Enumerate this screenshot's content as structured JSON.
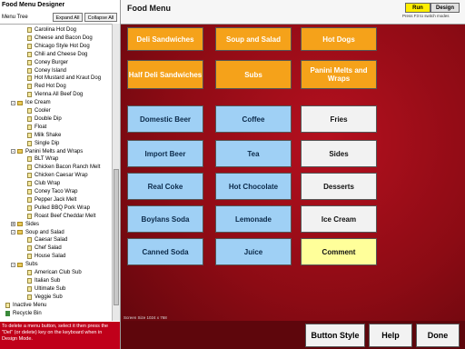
{
  "app": {
    "title": "Food Menu Designer",
    "tree_label": "Menu Tree",
    "expand_all": "Expand All",
    "collapse_all": "Collapse All"
  },
  "tree": [
    {
      "label": "Carolina Hot Dog",
      "level": 3,
      "kind": "item"
    },
    {
      "label": "Cheese and Bacon Dog",
      "level": 3,
      "kind": "item"
    },
    {
      "label": "Chicago Style Hot Dog",
      "level": 3,
      "kind": "item"
    },
    {
      "label": "Chili and Cheese Dog",
      "level": 3,
      "kind": "item"
    },
    {
      "label": "Coney Burger",
      "level": 3,
      "kind": "item"
    },
    {
      "label": "Coney Island",
      "level": 3,
      "kind": "item"
    },
    {
      "label": "Hot Mustard and Kraut Dog",
      "level": 3,
      "kind": "item"
    },
    {
      "label": "Red Hot Dog",
      "level": 3,
      "kind": "item"
    },
    {
      "label": "Vienna All Beef Dog",
      "level": 3,
      "kind": "item"
    },
    {
      "label": "Ice Cream",
      "level": 2,
      "kind": "folder",
      "exp": "-"
    },
    {
      "label": "Cooler",
      "level": 3,
      "kind": "item"
    },
    {
      "label": "Double Dip",
      "level": 3,
      "kind": "item"
    },
    {
      "label": "Float",
      "level": 3,
      "kind": "item"
    },
    {
      "label": "Milk Shake",
      "level": 3,
      "kind": "item"
    },
    {
      "label": "Single Dip",
      "level": 3,
      "kind": "item"
    },
    {
      "label": "Panini Melts and Wraps",
      "level": 2,
      "kind": "folder",
      "exp": "-"
    },
    {
      "label": "BLT Wrap",
      "level": 3,
      "kind": "item"
    },
    {
      "label": "Chicken Bacon Ranch Melt",
      "level": 3,
      "kind": "item"
    },
    {
      "label": "Chicken Caesar Wrap",
      "level": 3,
      "kind": "item"
    },
    {
      "label": "Club Wrap",
      "level": 3,
      "kind": "item"
    },
    {
      "label": "Coney Taco Wrap",
      "level": 3,
      "kind": "item"
    },
    {
      "label": "Pepper Jack Melt",
      "level": 3,
      "kind": "item"
    },
    {
      "label": "Pulled BBQ Pork Wrap",
      "level": 3,
      "kind": "item"
    },
    {
      "label": "Roast Beef Cheddar Melt",
      "level": 3,
      "kind": "item"
    },
    {
      "label": "Sides",
      "level": 2,
      "kind": "folder",
      "exp": "+"
    },
    {
      "label": "Soup and Salad",
      "level": 2,
      "kind": "folder",
      "exp": "-"
    },
    {
      "label": "Caesar Salad",
      "level": 3,
      "kind": "item"
    },
    {
      "label": "Chef Salad",
      "level": 3,
      "kind": "item"
    },
    {
      "label": "House Salad",
      "level": 3,
      "kind": "item"
    },
    {
      "label": "Subs",
      "level": 2,
      "kind": "folder",
      "exp": "-"
    },
    {
      "label": "American Club Sub",
      "level": 3,
      "kind": "item"
    },
    {
      "label": "Italian Sub",
      "level": 3,
      "kind": "item"
    },
    {
      "label": "Ultimate Sub",
      "level": 3,
      "kind": "item"
    },
    {
      "label": "Veggie Sub",
      "level": 3,
      "kind": "item"
    },
    {
      "label": "Inactive Menu",
      "level": 1,
      "kind": "item"
    },
    {
      "label": "Recycle Bin",
      "level": 1,
      "kind": "bin"
    }
  ],
  "note": "To delete a menu button, select it then press the \"Del\" (or delete) key on the keyboard when in Design Mode.",
  "menu": {
    "title": "Food Menu",
    "mode_run": "Run",
    "mode_design": "Design",
    "mode_hint": "Press F3 to switch modes",
    "screen_size": "Screen Size 1024 x 768",
    "buttons": [
      {
        "label": "Deli Sandwiches",
        "color": "orange"
      },
      {
        "label": "Soup and Salad",
        "color": "orange"
      },
      {
        "label": "Hot Dogs",
        "color": "orange"
      },
      {
        "label": "Half Deli Sandwiches",
        "color": "orange"
      },
      {
        "label": "Subs",
        "color": "orange"
      },
      {
        "label": "Panini Melts and Wraps",
        "color": "orange"
      },
      {
        "label": "Domestic Beer",
        "color": "blue"
      },
      {
        "label": "Coffee",
        "color": "blue"
      },
      {
        "label": "Fries",
        "color": "white"
      },
      {
        "label": "Import Beer",
        "color": "blue"
      },
      {
        "label": "Tea",
        "color": "blue"
      },
      {
        "label": "Sides",
        "color": "white"
      },
      {
        "label": "Real Coke",
        "color": "blue"
      },
      {
        "label": "Hot Chocolate",
        "color": "blue"
      },
      {
        "label": "Desserts",
        "color": "white"
      },
      {
        "label": "Boylans Soda",
        "color": "blue"
      },
      {
        "label": "Lemonade",
        "color": "blue"
      },
      {
        "label": "Ice Cream",
        "color": "white"
      },
      {
        "label": "Canned Soda",
        "color": "blue"
      },
      {
        "label": "Juice",
        "color": "blue"
      },
      {
        "label": "Comment",
        "color": "yellow"
      }
    ]
  },
  "footer": {
    "button_style": "Button Style",
    "help": "Help",
    "done": "Done"
  }
}
